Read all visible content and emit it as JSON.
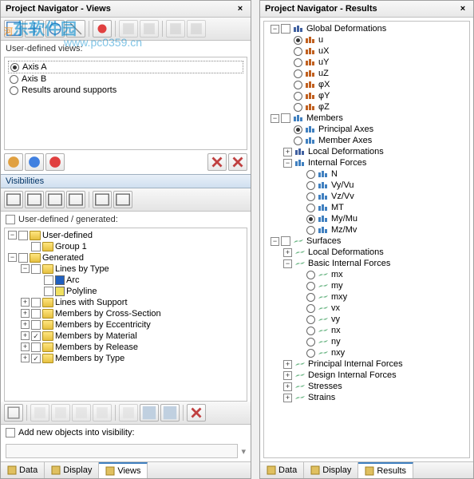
{
  "leftPanel": {
    "title": "Project Navigator - Views",
    "userDefinedLabel": "User-defined views:",
    "radioOptions": [
      {
        "label": "Axis A",
        "selected": true
      },
      {
        "label": "Axis B",
        "selected": false
      },
      {
        "label": "Results around supports",
        "selected": false
      }
    ],
    "visibilitiesHeader": "Visibilities",
    "userDefinedGenerated": "User-defined / generated:",
    "tree": [
      {
        "level": 0,
        "expander": "−",
        "checkbox": false,
        "icon": "folder",
        "label": "User-defined"
      },
      {
        "level": 1,
        "expander": "",
        "checkbox": false,
        "icon": "folder",
        "label": "Group 1"
      },
      {
        "level": 0,
        "expander": "−",
        "checkbox": false,
        "icon": "folder",
        "label": "Generated"
      },
      {
        "level": 1,
        "expander": "−",
        "checkbox": false,
        "icon": "folder",
        "label": "Lines by Type"
      },
      {
        "level": 2,
        "expander": "",
        "checkbox": false,
        "icon": "color",
        "color": "#2060c0",
        "label": "Arc"
      },
      {
        "level": 2,
        "expander": "",
        "checkbox": false,
        "icon": "color",
        "color": "#f0e060",
        "label": "Polyline"
      },
      {
        "level": 1,
        "expander": "+",
        "checkbox": false,
        "icon": "folder",
        "label": "Lines with Support"
      },
      {
        "level": 1,
        "expander": "+",
        "checkbox": false,
        "icon": "folder",
        "label": "Members by Cross-Section"
      },
      {
        "level": 1,
        "expander": "+",
        "checkbox": false,
        "icon": "folder",
        "label": "Members by Eccentricity"
      },
      {
        "level": 1,
        "expander": "+",
        "checkbox": true,
        "icon": "folder",
        "label": "Members by Material"
      },
      {
        "level": 1,
        "expander": "+",
        "checkbox": false,
        "icon": "folder",
        "label": "Members by Release"
      },
      {
        "level": 1,
        "expander": "+",
        "checkbox": true,
        "icon": "folder",
        "label": "Members by Type"
      }
    ],
    "addNewLabel": "Add new objects into visibility:",
    "tabs": [
      {
        "label": "Data",
        "active": false
      },
      {
        "label": "Display",
        "active": false
      },
      {
        "label": "Views",
        "active": true
      }
    ]
  },
  "rightPanel": {
    "title": "Project Navigator - Results",
    "tree": [
      {
        "level": 0,
        "expander": "−",
        "checkbox": "unchecked",
        "radio": null,
        "icon": "deform",
        "label": "Global Deformations"
      },
      {
        "level": 1,
        "expander": "",
        "radio": "checked",
        "icon": "u",
        "label": "u"
      },
      {
        "level": 1,
        "expander": "",
        "radio": "unchecked",
        "icon": "u",
        "label": "uX"
      },
      {
        "level": 1,
        "expander": "",
        "radio": "unchecked",
        "icon": "u",
        "label": "uY"
      },
      {
        "level": 1,
        "expander": "",
        "radio": "unchecked",
        "icon": "u",
        "label": "uZ"
      },
      {
        "level": 1,
        "expander": "",
        "radio": "unchecked",
        "icon": "phi",
        "label": "φX"
      },
      {
        "level": 1,
        "expander": "",
        "radio": "unchecked",
        "icon": "phi",
        "label": "φY"
      },
      {
        "level": 1,
        "expander": "",
        "radio": "unchecked",
        "icon": "phi",
        "label": "φZ"
      },
      {
        "level": 0,
        "expander": "−",
        "checkbox": "unchecked",
        "radio": null,
        "icon": "member",
        "label": "Members"
      },
      {
        "level": 1,
        "expander": "",
        "radio": "checked",
        "icon": "axes",
        "label": "Principal Axes"
      },
      {
        "level": 1,
        "expander": "",
        "radio": "unchecked",
        "icon": "axes",
        "label": "Member Axes"
      },
      {
        "level": 1,
        "expander": "+",
        "radio": null,
        "icon": "deform",
        "label": "Local Deformations"
      },
      {
        "level": 1,
        "expander": "−",
        "radio": null,
        "icon": "force",
        "label": "Internal Forces"
      },
      {
        "level": 2,
        "expander": "",
        "radio": "unchecked",
        "icon": "n",
        "label": "N"
      },
      {
        "level": 2,
        "expander": "",
        "radio": "unchecked",
        "icon": "v",
        "label": "Vy/Vu"
      },
      {
        "level": 2,
        "expander": "",
        "radio": "unchecked",
        "icon": "v",
        "label": "Vz/Vv"
      },
      {
        "level": 2,
        "expander": "",
        "radio": "unchecked",
        "icon": "m",
        "label": "MT"
      },
      {
        "level": 2,
        "expander": "",
        "radio": "checked",
        "icon": "m",
        "label": "My/Mu"
      },
      {
        "level": 2,
        "expander": "",
        "radio": "unchecked",
        "icon": "m",
        "label": "Mz/Mv"
      },
      {
        "level": 0,
        "expander": "−",
        "checkbox": "unchecked",
        "radio": null,
        "icon": "surface",
        "label": "Surfaces"
      },
      {
        "level": 1,
        "expander": "+",
        "radio": null,
        "icon": "surface",
        "label": "Local Deformations"
      },
      {
        "level": 1,
        "expander": "−",
        "radio": null,
        "icon": "surface",
        "label": "Basic Internal Forces"
      },
      {
        "level": 2,
        "expander": "",
        "radio": "unchecked",
        "icon": "surface",
        "label": "mx"
      },
      {
        "level": 2,
        "expander": "",
        "radio": "unchecked",
        "icon": "surface",
        "label": "my"
      },
      {
        "level": 2,
        "expander": "",
        "radio": "unchecked",
        "icon": "surface",
        "label": "mxy"
      },
      {
        "level": 2,
        "expander": "",
        "radio": "unchecked",
        "icon": "surface",
        "label": "vx"
      },
      {
        "level": 2,
        "expander": "",
        "radio": "unchecked",
        "icon": "surface",
        "label": "vy"
      },
      {
        "level": 2,
        "expander": "",
        "radio": "unchecked",
        "icon": "surface",
        "label": "nx"
      },
      {
        "level": 2,
        "expander": "",
        "radio": "unchecked",
        "icon": "surface",
        "label": "ny"
      },
      {
        "level": 2,
        "expander": "",
        "radio": "unchecked",
        "icon": "surface",
        "label": "nxy"
      },
      {
        "level": 1,
        "expander": "+",
        "radio": null,
        "icon": "surface",
        "label": "Principal Internal Forces"
      },
      {
        "level": 1,
        "expander": "+",
        "radio": null,
        "icon": "surface",
        "label": "Design Internal Forces"
      },
      {
        "level": 1,
        "expander": "+",
        "radio": null,
        "icon": "surface",
        "label": "Stresses"
      },
      {
        "level": 1,
        "expander": "+",
        "radio": null,
        "icon": "surface",
        "label": "Strains"
      }
    ],
    "tabs": [
      {
        "label": "Data",
        "active": false
      },
      {
        "label": "Display",
        "active": false
      },
      {
        "label": "Results",
        "active": true
      }
    ]
  }
}
